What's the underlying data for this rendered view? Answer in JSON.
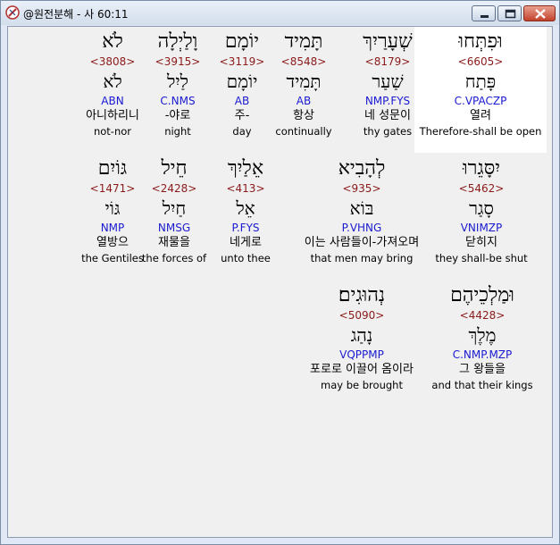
{
  "window": {
    "title": "@원전분해 - 사 60:11"
  },
  "rows": [
    [
      {
        "heb": "וּפִתְּחוּ",
        "strong": "<6605>",
        "root": "פָּתַח",
        "morph": "C.VPACZP",
        "kor": "열려",
        "eng": "Therefore-shall be open"
      },
      {
        "heb": "שְׁעָרַיִךְ",
        "strong": "<8179>",
        "root": "שַׁעַר",
        "morph": "NMP.FYS",
        "kor": "네 성문이",
        "eng": "thy gates"
      },
      {
        "heb": "תָּמִיד",
        "strong": "<8548>",
        "root": "תָּמִיד",
        "morph": "AB",
        "kor": "항상",
        "eng": "continually"
      },
      {
        "heb": "יוֹמָם",
        "strong": "<3119>",
        "root": "יוֹמָם",
        "morph": "AB",
        "kor": "주-",
        "eng": "day"
      },
      {
        "heb": "וָלַיְלָה",
        "strong": "<3915>",
        "root": "לַיִל",
        "morph": "C.NMS",
        "kor": "-야로",
        "eng": "night"
      },
      {
        "heb": "לֹא",
        "strong": "<3808>",
        "root": "לֹא",
        "morph": "ABN",
        "kor": "아니하리니",
        "eng": "not-nor"
      }
    ],
    [
      {
        "heb": "יִסָּגֵרוּ",
        "strong": "<5462>",
        "root": "סָגַר",
        "morph": "VNIMZP",
        "kor": "닫히지",
        "eng": "they shall-be shut"
      },
      {
        "heb": "לְהָבִיא",
        "strong": "<935>",
        "root": "בּוֹא",
        "morph": "P.VHNG",
        "kor": "이는 사람들이-가져오며",
        "eng": "that men may bring"
      },
      {
        "heb": "אֵלַיִךְ",
        "strong": "<413>",
        "root": "אֵל",
        "morph": "P.FYS",
        "kor": "네게로",
        "eng": "unto thee"
      },
      {
        "heb": "חֵיל",
        "strong": "<2428>",
        "root": "חַיִל",
        "morph": "NMSG",
        "kor": "재물을",
        "eng": "the forces of"
      },
      {
        "heb": "גּוֹיִם",
        "strong": "<1471>",
        "root": "גּוֹי",
        "morph": "NMP",
        "kor": "열방으",
        "eng": "the Gentiles"
      }
    ],
    [
      {
        "heb": "וּמַלְכֵיהֶם",
        "strong": "<4428>",
        "root": "מֶלֶךְ",
        "morph": "C.NMP.MZP",
        "kor": "그 왕들을",
        "eng": "and that their kings"
      },
      {
        "heb": "נְהוּגִים׃",
        "strong": "<5090>",
        "root": "נָהַג",
        "morph": "VQPPMP",
        "kor": "포로로 이끌어 옴이라",
        "eng": "may be brought"
      }
    ]
  ]
}
